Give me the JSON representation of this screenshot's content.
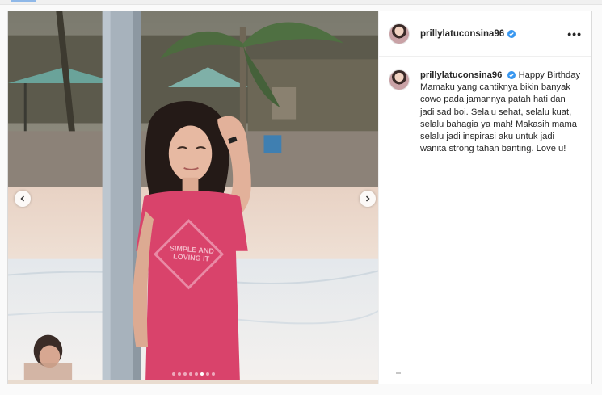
{
  "post": {
    "username": "prillylatuconsina96",
    "verified": true,
    "more_label": "•••",
    "caption": "Happy Birthday Mamaku yang cantiknya bikin banyak cowo pada jamannya patah hati dan jadi sad boi. Selalu sehat, selalu kuat, selalu bahagia ya mah! Makasih mama selalu jadi inspirasi aku untuk jadi wanita strong tahan banting. Love u!"
  },
  "carousel": {
    "slide_count": 8,
    "active_index": 5
  },
  "photo": {
    "tshirt_text": "SIMPLE AND LOVING IT"
  },
  "colors": {
    "verified_badge": "#3897f0",
    "border": "#dbdbdb",
    "text": "#262626",
    "tshirt": "#d9436b"
  },
  "icons": {
    "prev": "chevron-left-icon",
    "next": "chevron-right-icon",
    "verified": "verified-badge-icon",
    "more": "more-options-icon"
  }
}
